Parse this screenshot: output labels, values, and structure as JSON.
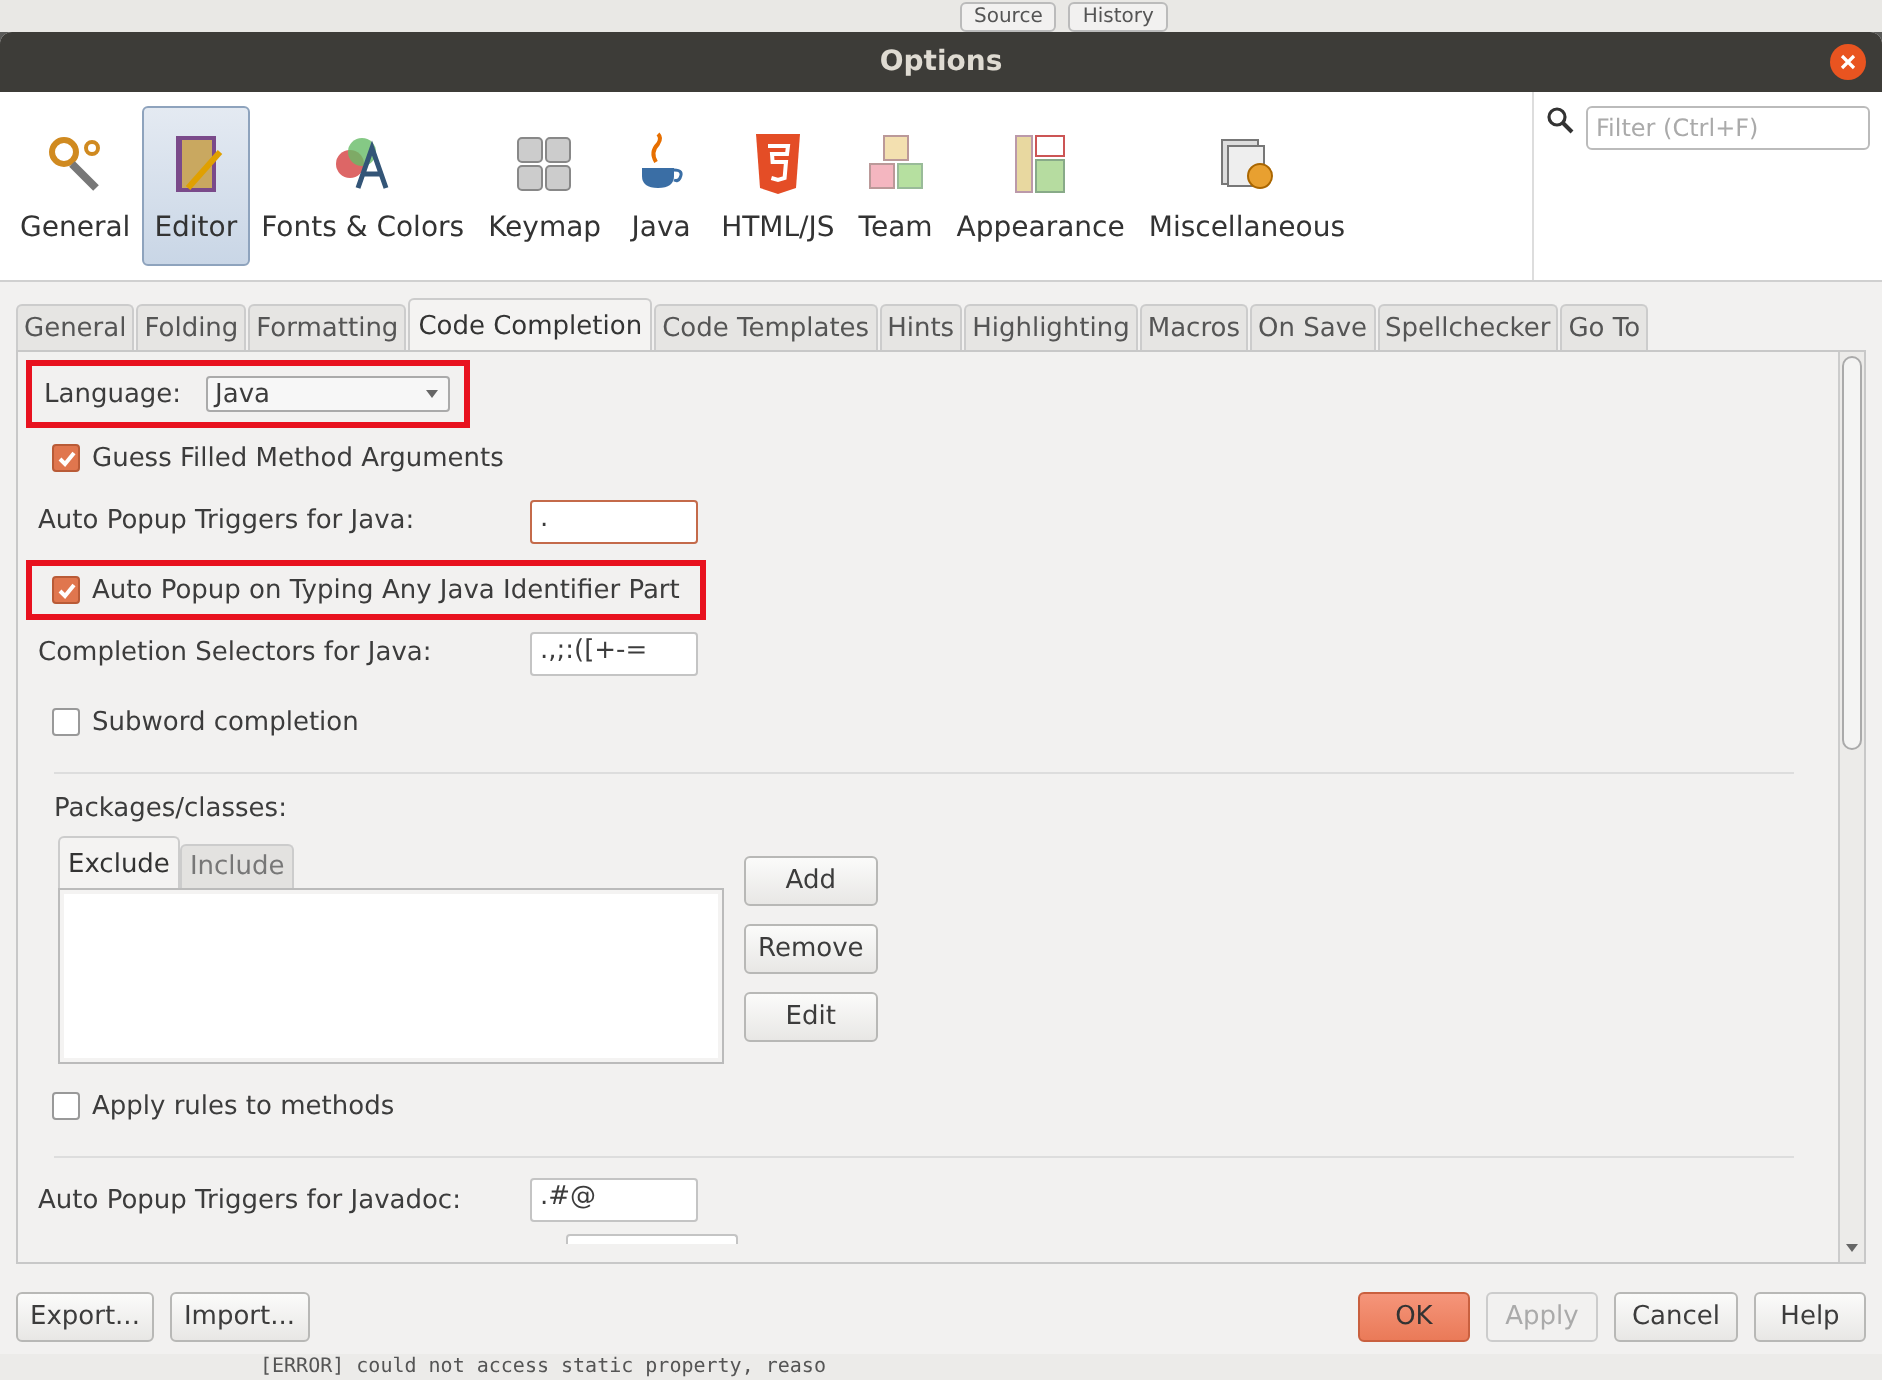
{
  "background": {
    "toolbar_buttons": [
      "Source",
      "History"
    ],
    "console_line": "[ERROR] could not access static property, reaso"
  },
  "window": {
    "title": "Options"
  },
  "categories": [
    {
      "label": "General",
      "selected": false
    },
    {
      "label": "Editor",
      "selected": true
    },
    {
      "label": "Fonts & Colors",
      "selected": false
    },
    {
      "label": "Keymap",
      "selected": false
    },
    {
      "label": "Java",
      "selected": false
    },
    {
      "label": "HTML/JS",
      "selected": false
    },
    {
      "label": "Team",
      "selected": false
    },
    {
      "label": "Appearance",
      "selected": false
    },
    {
      "label": "Miscellaneous",
      "selected": false
    }
  ],
  "filter": {
    "placeholder": "Filter (Ctrl+F)"
  },
  "tabs": [
    {
      "label": "General",
      "selected": false
    },
    {
      "label": "Folding",
      "selected": false
    },
    {
      "label": "Formatting",
      "selected": false
    },
    {
      "label": "Code Completion",
      "selected": true
    },
    {
      "label": "Code Templates",
      "selected": false
    },
    {
      "label": "Hints",
      "selected": false
    },
    {
      "label": "Highlighting",
      "selected": false
    },
    {
      "label": "Macros",
      "selected": false
    },
    {
      "label": "On Save",
      "selected": false
    },
    {
      "label": "Spellchecker",
      "selected": false
    },
    {
      "label": "Go To",
      "selected": false
    }
  ],
  "settings": [
    {
      "kind": "dropdown",
      "label": "Language:",
      "value": "Java",
      "highlighted": true
    },
    {
      "kind": "checkbox",
      "label": "Guess Filled Method Arguments",
      "checked": true,
      "highlighted": false
    },
    {
      "kind": "field",
      "label": "Auto Popup Triggers for Java:",
      "value": ".",
      "focused": true,
      "highlighted": false
    },
    {
      "kind": "checkbox",
      "label": "Auto Popup on Typing Any Java Identifier Part",
      "checked": true,
      "highlighted": true
    },
    {
      "kind": "field",
      "label": "Completion Selectors for Java:",
      "value": ".,;:([+-=",
      "focused": false,
      "highlighted": false
    },
    {
      "kind": "checkbox",
      "label": "Subword completion",
      "checked": false,
      "highlighted": false
    }
  ],
  "packages": {
    "label": "Packages/classes:",
    "tabs": [
      {
        "label": "Exclude",
        "selected": true
      },
      {
        "label": "Include",
        "selected": false
      }
    ],
    "buttons": [
      "Add",
      "Remove",
      "Edit"
    ],
    "apply_rules": {
      "label": "Apply rules to methods",
      "checked": false
    }
  },
  "javadoc_field": {
    "label": "Auto Popup Triggers for Javadoc:",
    "value": ".#@"
  },
  "footer": {
    "left_buttons": [
      "Export...",
      "Import..."
    ],
    "right_buttons": [
      {
        "label": "OK",
        "default": true,
        "disabled": false
      },
      {
        "label": "Apply",
        "default": false,
        "disabled": true
      },
      {
        "label": "Cancel",
        "default": false,
        "disabled": false
      },
      {
        "label": "Help",
        "default": false,
        "disabled": false
      }
    ]
  }
}
